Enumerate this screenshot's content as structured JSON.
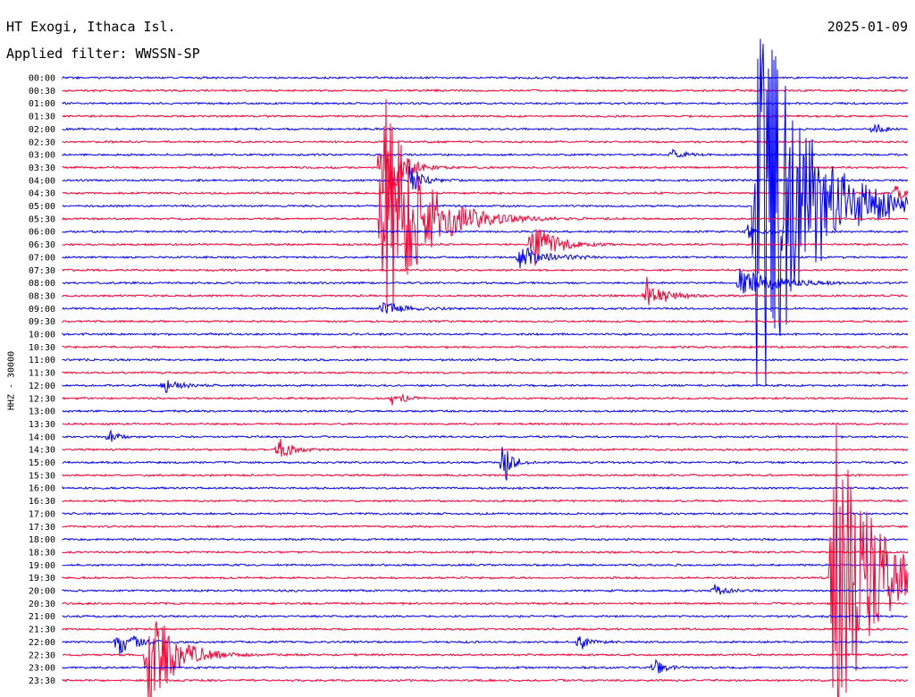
{
  "header": {
    "station": "HT Exogi, Ithaca Isl.",
    "filter": "Applied filter: WWSSN-SP",
    "date": "2025-01-09"
  },
  "chart_data": {
    "type": "line",
    "title": "HT Exogi, Ithaca Isl.",
    "subtitle": "Applied filter: WWSSN-SP",
    "ylabel": "HHZ - 30000",
    "xlabel": "",
    "date": "2025-01-09",
    "row_labels": [
      "00:00",
      "00:30",
      "01:00",
      "01:30",
      "02:00",
      "02:30",
      "03:00",
      "03:30",
      "04:00",
      "04:30",
      "05:00",
      "05:30",
      "06:00",
      "06:30",
      "07:00",
      "07:30",
      "08:00",
      "08:30",
      "09:00",
      "09:30",
      "10:00",
      "10:30",
      "11:00",
      "11:30",
      "12:00",
      "12:30",
      "13:00",
      "13:30",
      "14:00",
      "14:30",
      "15:00",
      "15:30",
      "16:00",
      "16:30",
      "17:00",
      "17:30",
      "18:00",
      "18:30",
      "19:00",
      "19:30",
      "20:00",
      "20:30",
      "21:00",
      "21:30",
      "22:00",
      "22:30",
      "23:00",
      "23:30"
    ],
    "colors": [
      "#0000ff",
      "#ff0033"
    ],
    "grid": false,
    "events": [
      {
        "row": 11,
        "x": 0.378,
        "amp": 150,
        "dur": 0.09
      },
      {
        "row": 7,
        "x": 0.377,
        "amp": 55,
        "dur": 0.04
      },
      {
        "row": 8,
        "x": 0.41,
        "amp": 18,
        "dur": 0.03
      },
      {
        "row": 18,
        "x": 0.378,
        "amp": 10,
        "dur": 0.05
      },
      {
        "row": 13,
        "x": 0.555,
        "amp": 30,
        "dur": 0.05
      },
      {
        "row": 14,
        "x": 0.54,
        "amp": 15,
        "dur": 0.06
      },
      {
        "row": 16,
        "x": 0.8,
        "amp": 18,
        "dur": 0.08
      },
      {
        "row": 17,
        "x": 0.69,
        "amp": 22,
        "dur": 0.04
      },
      {
        "row": 12,
        "x": 0.81,
        "amp": 9,
        "dur": 0.03
      },
      {
        "row": 10,
        "x": 0.82,
        "amp": 260,
        "dur": 0.12
      },
      {
        "row": 30,
        "x": 0.52,
        "amp": 35,
        "dur": 0.02
      },
      {
        "row": 29,
        "x": 0.255,
        "amp": 14,
        "dur": 0.03
      },
      {
        "row": 28,
        "x": 0.055,
        "amp": 9,
        "dur": 0.02
      },
      {
        "row": 24,
        "x": 0.12,
        "amp": 8,
        "dur": 0.04
      },
      {
        "row": 25,
        "x": 0.39,
        "amp": 9,
        "dur": 0.03
      },
      {
        "row": 39,
        "x": 0.91,
        "amp": 210,
        "dur": 0.09
      },
      {
        "row": 44,
        "x": 0.065,
        "amp": 18,
        "dur": 0.04
      },
      {
        "row": 45,
        "x": 0.1,
        "amp": 75,
        "dur": 0.06
      },
      {
        "row": 44,
        "x": 0.61,
        "amp": 14,
        "dur": 0.02
      },
      {
        "row": 46,
        "x": 0.7,
        "amp": 9,
        "dur": 0.03
      },
      {
        "row": 4,
        "x": 0.96,
        "amp": 9,
        "dur": 0.02
      },
      {
        "row": 9,
        "x": 0.985,
        "amp": 10,
        "dur": 0.02
      },
      {
        "row": 6,
        "x": 0.72,
        "amp": 6,
        "dur": 0.03
      },
      {
        "row": 40,
        "x": 0.77,
        "amp": 7,
        "dur": 0.03
      }
    ]
  }
}
